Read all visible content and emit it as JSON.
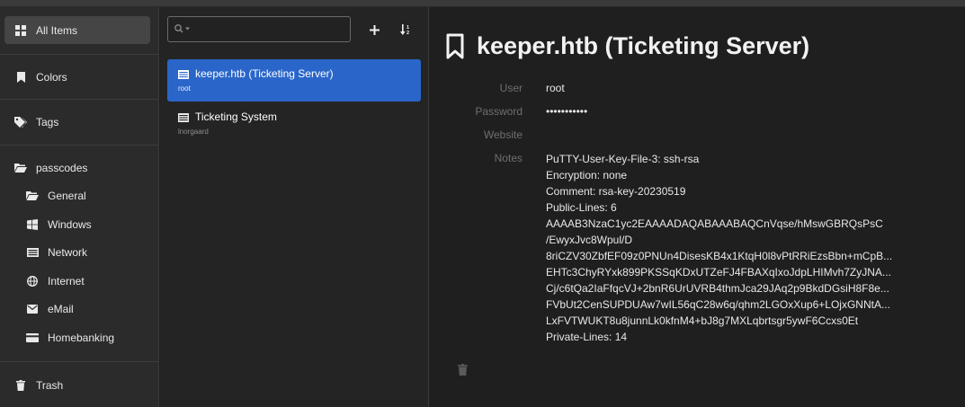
{
  "sidebar": {
    "all_items": "All Items",
    "colors": "Colors",
    "tags": "Tags",
    "passcodes": "passcodes",
    "folders": [
      {
        "label": "General",
        "icon": "folder-open-icon"
      },
      {
        "label": "Windows",
        "icon": "windows-icon"
      },
      {
        "label": "Network",
        "icon": "network-icon"
      },
      {
        "label": "Internet",
        "icon": "globe-icon"
      },
      {
        "label": "eMail",
        "icon": "envelope-icon"
      },
      {
        "label": "Homebanking",
        "icon": "credit-card-icon"
      }
    ],
    "trash": "Trash"
  },
  "list": {
    "search_placeholder": "",
    "entries": [
      {
        "title": "keeper.htb (Ticketing Server)",
        "subtitle": "root",
        "selected": true
      },
      {
        "title": "Ticketing System",
        "subtitle": "lnorgaard",
        "selected": false
      }
    ]
  },
  "detail": {
    "title": "keeper.htb (Ticketing Server)",
    "fields": {
      "user_label": "User",
      "user_value": "root",
      "password_label": "Password",
      "password_value": "•••••••••••",
      "website_label": "Website",
      "website_value": "",
      "notes_label": "Notes"
    },
    "notes_lines": [
      "PuTTY-User-Key-File-3: ssh-rsa",
      "Encryption: none",
      "Comment: rsa-key-20230519",
      "Public-Lines: 6",
      "AAAAB3NzaC1yc2EAAAADAQABAAABAQCnVqse/hMswGBRQsPsC",
      "/EwyxJvc8Wpul/D",
      "8riCZV30ZbfEF09z0PNUn4DisesKB4x1KtqH0l8vPtRRiEzsBbn+mCpB...",
      "EHTc3ChyRYxk899PKSSqKDxUTZeFJ4FBAXqIxoJdpLHIMvh7ZyJNA...",
      "Cj/c6tQa2IaFfqcVJ+2bnR6UrUVRB4thmJca29JAq2p9BkdDGsiH8F8e...",
      "FVbUt2CenSUPDUAw7wIL56qC28w6q/qhm2LGOxXup6+LOjxGNNtA...",
      "LxFVTWUKT8u8junnLk0kfnM4+bJ8g7MXLqbrtsgr5ywF6Ccxs0Et",
      "Private-Lines: 14"
    ]
  },
  "colors": {
    "selected_entry": "#2a66c9",
    "sidebar_bg": "#2b2b2b",
    "active_sidebar": "#454545"
  }
}
